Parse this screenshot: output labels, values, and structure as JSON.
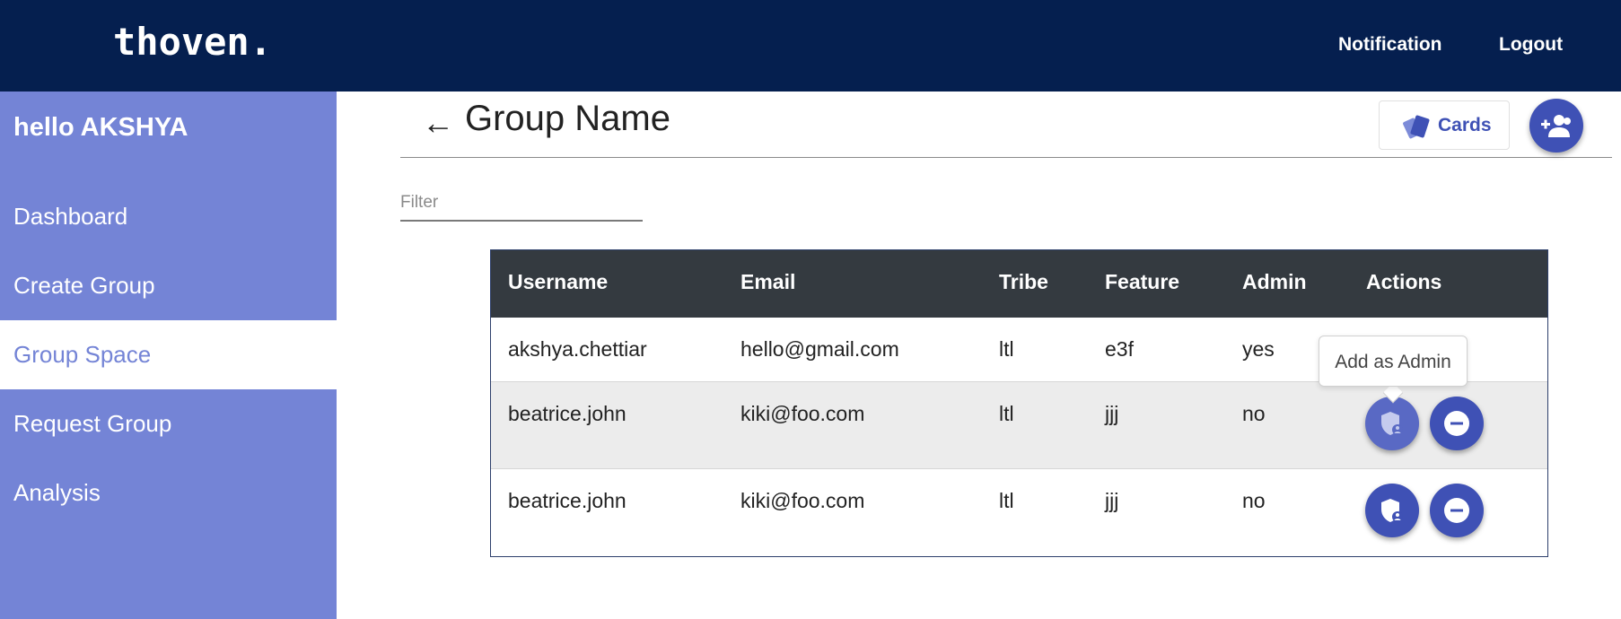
{
  "header": {
    "logo": "thoven.",
    "nav": {
      "notification": "Notification",
      "logout": "Logout"
    }
  },
  "sidebar": {
    "greeting": "hello AKSHYA",
    "items": [
      {
        "label": "Dashboard",
        "active": false
      },
      {
        "label": "Create Group",
        "active": false
      },
      {
        "label": "Group Space",
        "active": true
      },
      {
        "label": "Request Group",
        "active": false
      },
      {
        "label": "Analysis",
        "active": false
      }
    ]
  },
  "main": {
    "title": "Group Name",
    "back_icon": "arrow-left-icon",
    "cards_button": {
      "label": "Cards",
      "icon": "cards-icon"
    },
    "add_member_button": {
      "icon": "add-group-icon"
    },
    "filter": {
      "placeholder": "Filter",
      "value": ""
    }
  },
  "table": {
    "columns": [
      "Username",
      "Email",
      "Tribe",
      "Feature",
      "Admin",
      "Actions"
    ],
    "rows": [
      {
        "username": "akshya.chettiar",
        "email": "hello@gmail.com",
        "tribe": "ltl",
        "feature": "e3f",
        "admin": "yes"
      },
      {
        "username": "beatrice.john",
        "email": "kiki@foo.com",
        "tribe": "ltl",
        "feature": "jjj",
        "admin": "no"
      },
      {
        "username": "beatrice.john",
        "email": "kiki@foo.com",
        "tribe": "ltl",
        "feature": "jjj",
        "admin": "no"
      }
    ],
    "action_icons": {
      "admin": "admin-shield-icon",
      "remove": "remove-circle-icon"
    }
  },
  "tooltip": {
    "text": "Add as Admin"
  },
  "colors": {
    "topbar": "#051f4f",
    "sidebar": "#7484d6",
    "accent": "#3f51b5",
    "table_header": "#343a40"
  }
}
